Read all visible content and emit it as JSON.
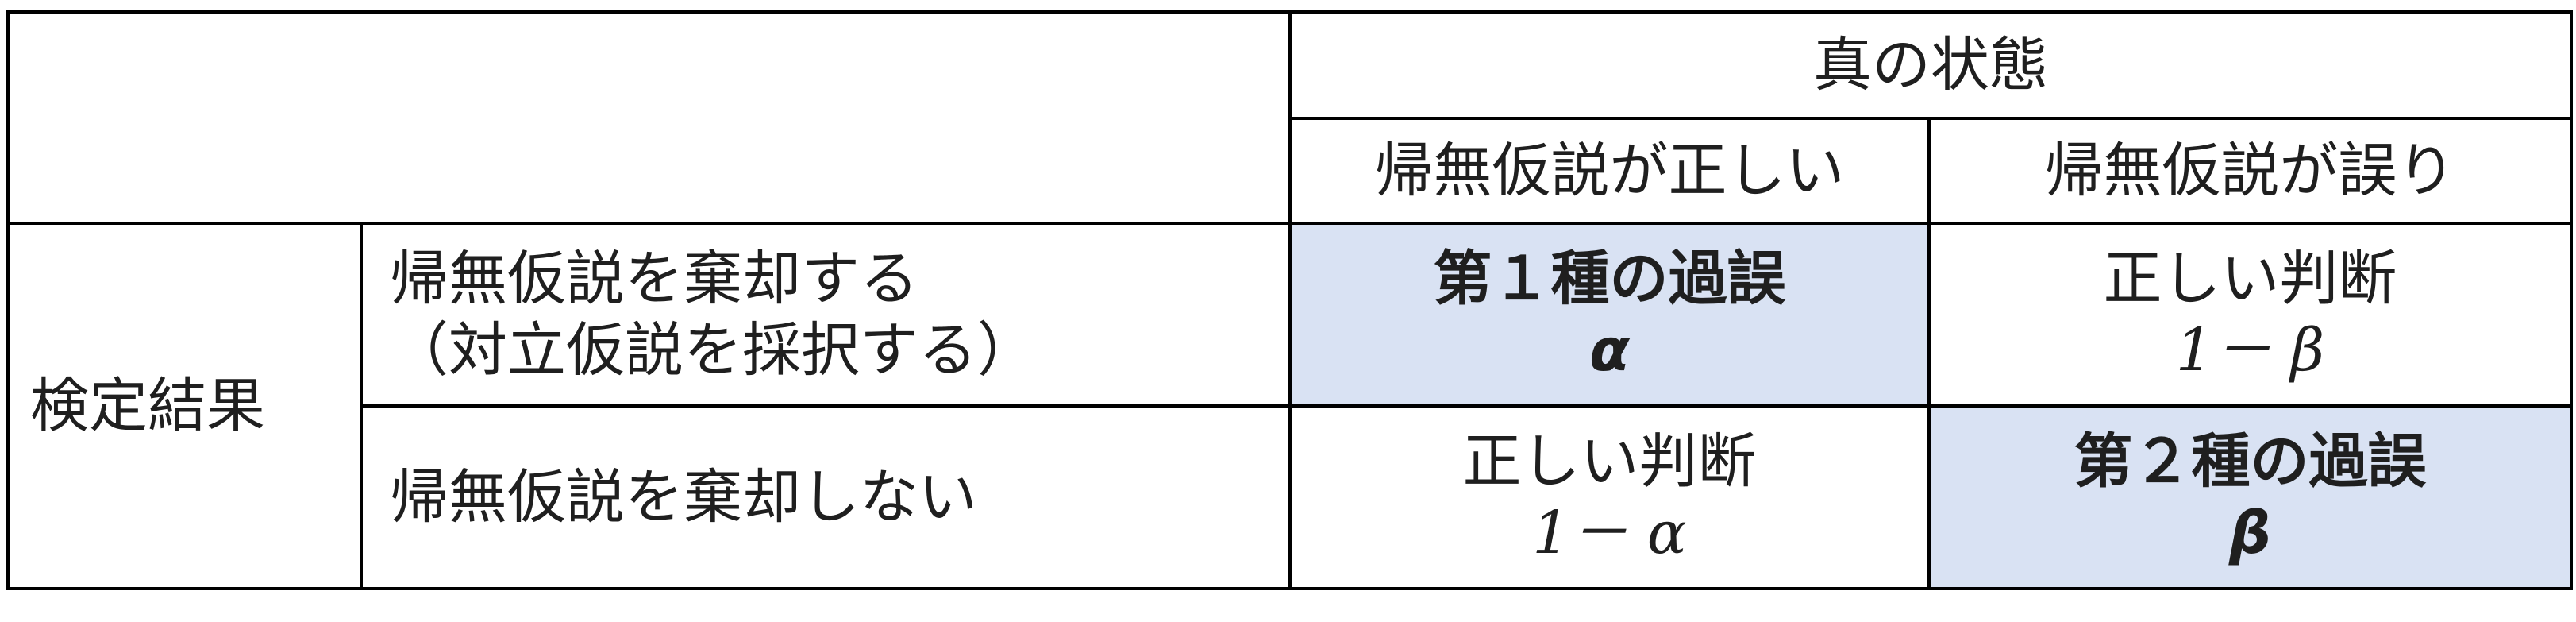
{
  "table": {
    "header": {
      "true_state": "真の状態",
      "null_true": "帰無仮説が正しい",
      "null_false": "帰無仮説が誤り"
    },
    "row_group_label": "検定結果",
    "rows": [
      {
        "decision_line1": "帰無仮説を棄却する",
        "decision_line2": "（対立仮説を採択する）",
        "cell_null_true": {
          "line1": "第１種の過誤",
          "line2": "α"
        },
        "cell_null_false": {
          "line1": "正しい判断",
          "line2": "1－ β"
        }
      },
      {
        "decision_line1": "帰無仮説を棄却しない",
        "cell_null_true": {
          "line1": "正しい判断",
          "line2": "1－ α"
        },
        "cell_null_false": {
          "line1": "第２種の過誤",
          "line2": "β"
        }
      }
    ],
    "highlight_color": "#d9e2f3"
  }
}
